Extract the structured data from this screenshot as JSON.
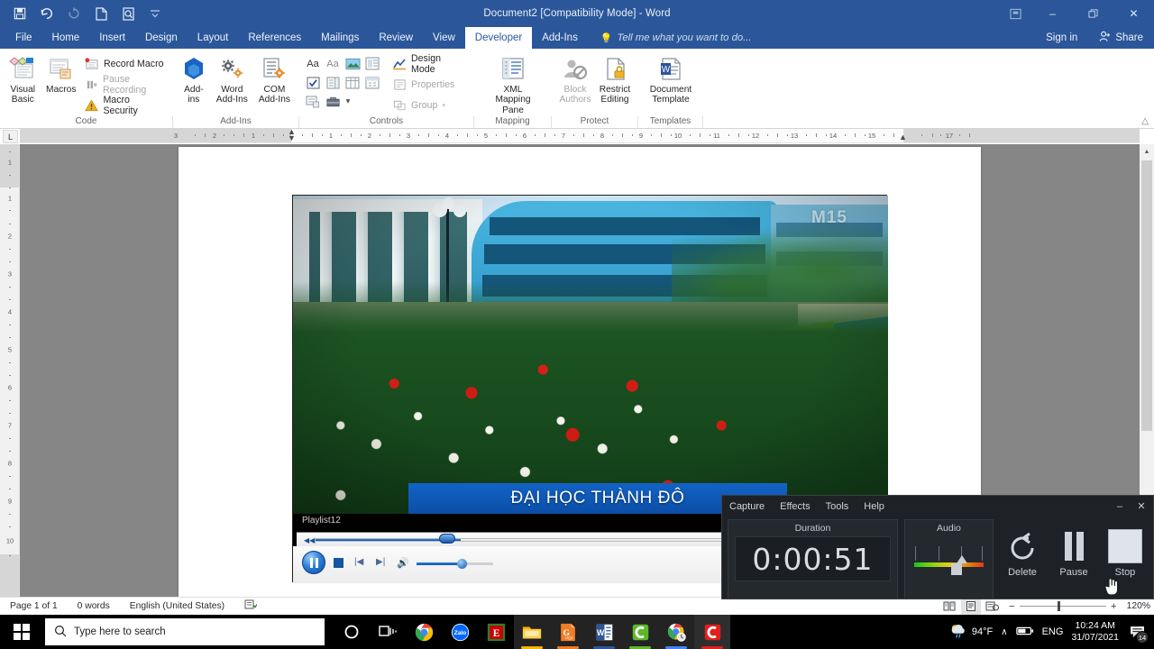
{
  "word": {
    "title": "Document2 [Compatibility Mode] - Word",
    "quick_access": [
      {
        "name": "save-icon",
        "glyph": "save"
      },
      {
        "name": "undo-icon",
        "glyph": "undo"
      },
      {
        "name": "redo-icon",
        "glyph": "redo"
      },
      {
        "name": "new-document-icon",
        "glyph": "page"
      },
      {
        "name": "print-preview-icon",
        "glyph": "preview"
      },
      {
        "name": "customize-quick-access-icon",
        "glyph": "chevron"
      }
    ],
    "window_controls": {
      "ribbon_display": "ribbon-display-options",
      "minimize": "–",
      "restore": "❐",
      "close": "✕"
    },
    "tabs": [
      {
        "label": "File",
        "active": false
      },
      {
        "label": "Home",
        "active": false
      },
      {
        "label": "Insert",
        "active": false
      },
      {
        "label": "Design",
        "active": false
      },
      {
        "label": "Layout",
        "active": false
      },
      {
        "label": "References",
        "active": false
      },
      {
        "label": "Mailings",
        "active": false
      },
      {
        "label": "Review",
        "active": false
      },
      {
        "label": "View",
        "active": false
      },
      {
        "label": "Developer",
        "active": true
      },
      {
        "label": "Add-Ins",
        "active": false
      }
    ],
    "tell_me": "Tell me what you want to do...",
    "sign_in": "Sign in",
    "share": "Share",
    "ribbon": {
      "groups": [
        {
          "label": "Code",
          "big_buttons": [
            {
              "label_line1": "Visual",
              "label_line2": "Basic",
              "icon": "visual-basic-icon"
            },
            {
              "label_line1": "Macros",
              "label_line2": "",
              "icon": "macros-icon"
            }
          ],
          "small_buttons": [
            {
              "label": "Record Macro",
              "icon": "record-macro-icon",
              "disabled": false
            },
            {
              "label": "Pause Recording",
              "icon": "pause-recording-icon",
              "disabled": true
            },
            {
              "label": "Macro Security",
              "icon": "macro-security-icon",
              "disabled": false
            }
          ]
        },
        {
          "label": "Add-Ins",
          "big_buttons": [
            {
              "label_line1": "Add-",
              "label_line2": "ins",
              "icon": "add-ins-icon"
            },
            {
              "label_line1": "Word",
              "label_line2": "Add-Ins",
              "icon": "word-add-ins-icon"
            },
            {
              "label_line1": "COM",
              "label_line2": "Add-Ins",
              "icon": "com-add-ins-icon"
            }
          ],
          "small_buttons": []
        },
        {
          "label": "Controls",
          "big_buttons": [],
          "small_buttons": [
            {
              "label": "Design Mode",
              "icon": "design-mode-icon",
              "disabled": false
            },
            {
              "label": "Properties",
              "icon": "properties-icon",
              "disabled": true
            },
            {
              "label": "Group",
              "icon": "group-icon",
              "disabled": true
            }
          ],
          "control_grid": [
            [
              "Aa",
              "Aa",
              "picture-content-control",
              "building-block-gallery"
            ],
            [
              "check-box-content-control",
              "combo-box-content-control",
              "drop-down-list-content-control",
              "date-picker-content-control"
            ],
            [
              "repeating-section-content-control",
              "legacy-tools-icon",
              "chevron-down-icon"
            ]
          ]
        },
        {
          "label": "Mapping",
          "big_buttons": [
            {
              "label_line1": "XML Mapping",
              "label_line2": "Pane",
              "icon": "xml-mapping-pane-icon"
            }
          ],
          "small_buttons": []
        },
        {
          "label": "Protect",
          "big_buttons": [
            {
              "label_line1": "Block",
              "label_line2": "Authors",
              "icon": "block-authors-icon",
              "disabled": true
            },
            {
              "label_line1": "Restrict",
              "label_line2": "Editing",
              "icon": "restrict-editing-icon"
            }
          ],
          "small_buttons": []
        },
        {
          "label": "Templates",
          "big_buttons": [
            {
              "label_line1": "Document",
              "label_line2": "Template",
              "icon": "document-template-icon"
            }
          ],
          "small_buttons": []
        }
      ],
      "collapse_label": "collapse-ribbon-icon"
    },
    "ruler": {
      "tab_selector": "L",
      "horizontal_left_labels": [
        "3",
        "2",
        "1"
      ],
      "horizontal_right_labels": [
        "1",
        "2",
        "3",
        "4",
        "5",
        "6",
        "7",
        "8",
        "9",
        "10",
        "11",
        "12",
        "13",
        "14",
        "15",
        "17"
      ],
      "vertical_labels": [
        "1",
        "1",
        "2",
        "3",
        "4",
        "5",
        "6",
        "7",
        "8",
        "9",
        "10"
      ]
    },
    "media_object": {
      "playlist_title": "Playlist12",
      "video_caption": "ĐẠI HỌC THÀNH ĐÔ",
      "watermark": "M15",
      "seek_position_pct": 26,
      "volume_pct": 58,
      "controls": [
        "play-pause-button",
        "stop-button",
        "previous-button",
        "next-button",
        "mute-button",
        "volume-slider"
      ]
    },
    "status_bar": {
      "page": "Page 1 of 1",
      "words": "0 words",
      "language": "English (United States)",
      "proofing_icon": "proofing-errors-icon",
      "views": [
        "read-mode-view",
        "print-layout-view",
        "web-layout-view"
      ],
      "active_view": "print-layout-view",
      "zoom_out": "−",
      "zoom_in": "+",
      "zoom_percent": "120%",
      "zoom_value": 120
    }
  },
  "recorder": {
    "menus": [
      "Capture",
      "Effects",
      "Tools",
      "Help"
    ],
    "window_controls": {
      "minimize": "–",
      "close": "✕"
    },
    "duration": {
      "label": "Duration",
      "value": "0:00:51"
    },
    "audio": {
      "label": "Audio",
      "level_pct": 60
    },
    "actions": [
      {
        "label": "Delete",
        "icon": "delete-undo-icon"
      },
      {
        "label": "Pause",
        "icon": "pause-icon"
      },
      {
        "label": "Stop",
        "icon": "stop-icon"
      }
    ],
    "cursor": "hand-pointer-cursor"
  },
  "taskbar": {
    "start": "start-button",
    "search_placeholder": "Type here to search",
    "icons": [
      {
        "name": "cortana-icon",
        "color": "#ffffff",
        "glyph": "○",
        "active": false
      },
      {
        "name": "task-view-icon",
        "color": "#ffffff",
        "glyph": "task-view",
        "active": false
      },
      {
        "name": "google-chrome-icon",
        "color": "#4285f4",
        "glyph": "chrome",
        "active": false
      },
      {
        "name": "zalo-icon",
        "color": "#0068ff",
        "glyph": "Zalo",
        "active": false
      },
      {
        "name": "eclipse-icon",
        "color": "#cc0000",
        "glyph": "E",
        "active": false
      },
      {
        "name": "file-explorer-icon",
        "color": "#ffb900",
        "glyph": "folder",
        "active": true
      },
      {
        "name": "pdf-app-icon",
        "color": "#e8762d",
        "glyph": "G",
        "active": true
      },
      {
        "name": "microsoft-word-icon",
        "color": "#2b579a",
        "glyph": "W",
        "active": true
      },
      {
        "name": "camtasia-studio-icon",
        "color": "#5db82c",
        "glyph": "C",
        "active": true
      },
      {
        "name": "chrome-secondary-icon",
        "color": "#4285f4",
        "glyph": "chrome",
        "active": true
      },
      {
        "name": "camtasia-recorder-icon",
        "color": "#e02020",
        "glyph": "C",
        "active": true
      }
    ],
    "tray": {
      "weather_icon": "partly-cloudy-rain-icon",
      "weather_temp": "94°F",
      "show_hidden_icons": "∧",
      "battery_icon": "battery-icon",
      "language": "ENG",
      "time": "10:24 AM",
      "date": "31/07/2021",
      "notifications_icon": "action-center-icon",
      "notifications_count": "14"
    }
  }
}
